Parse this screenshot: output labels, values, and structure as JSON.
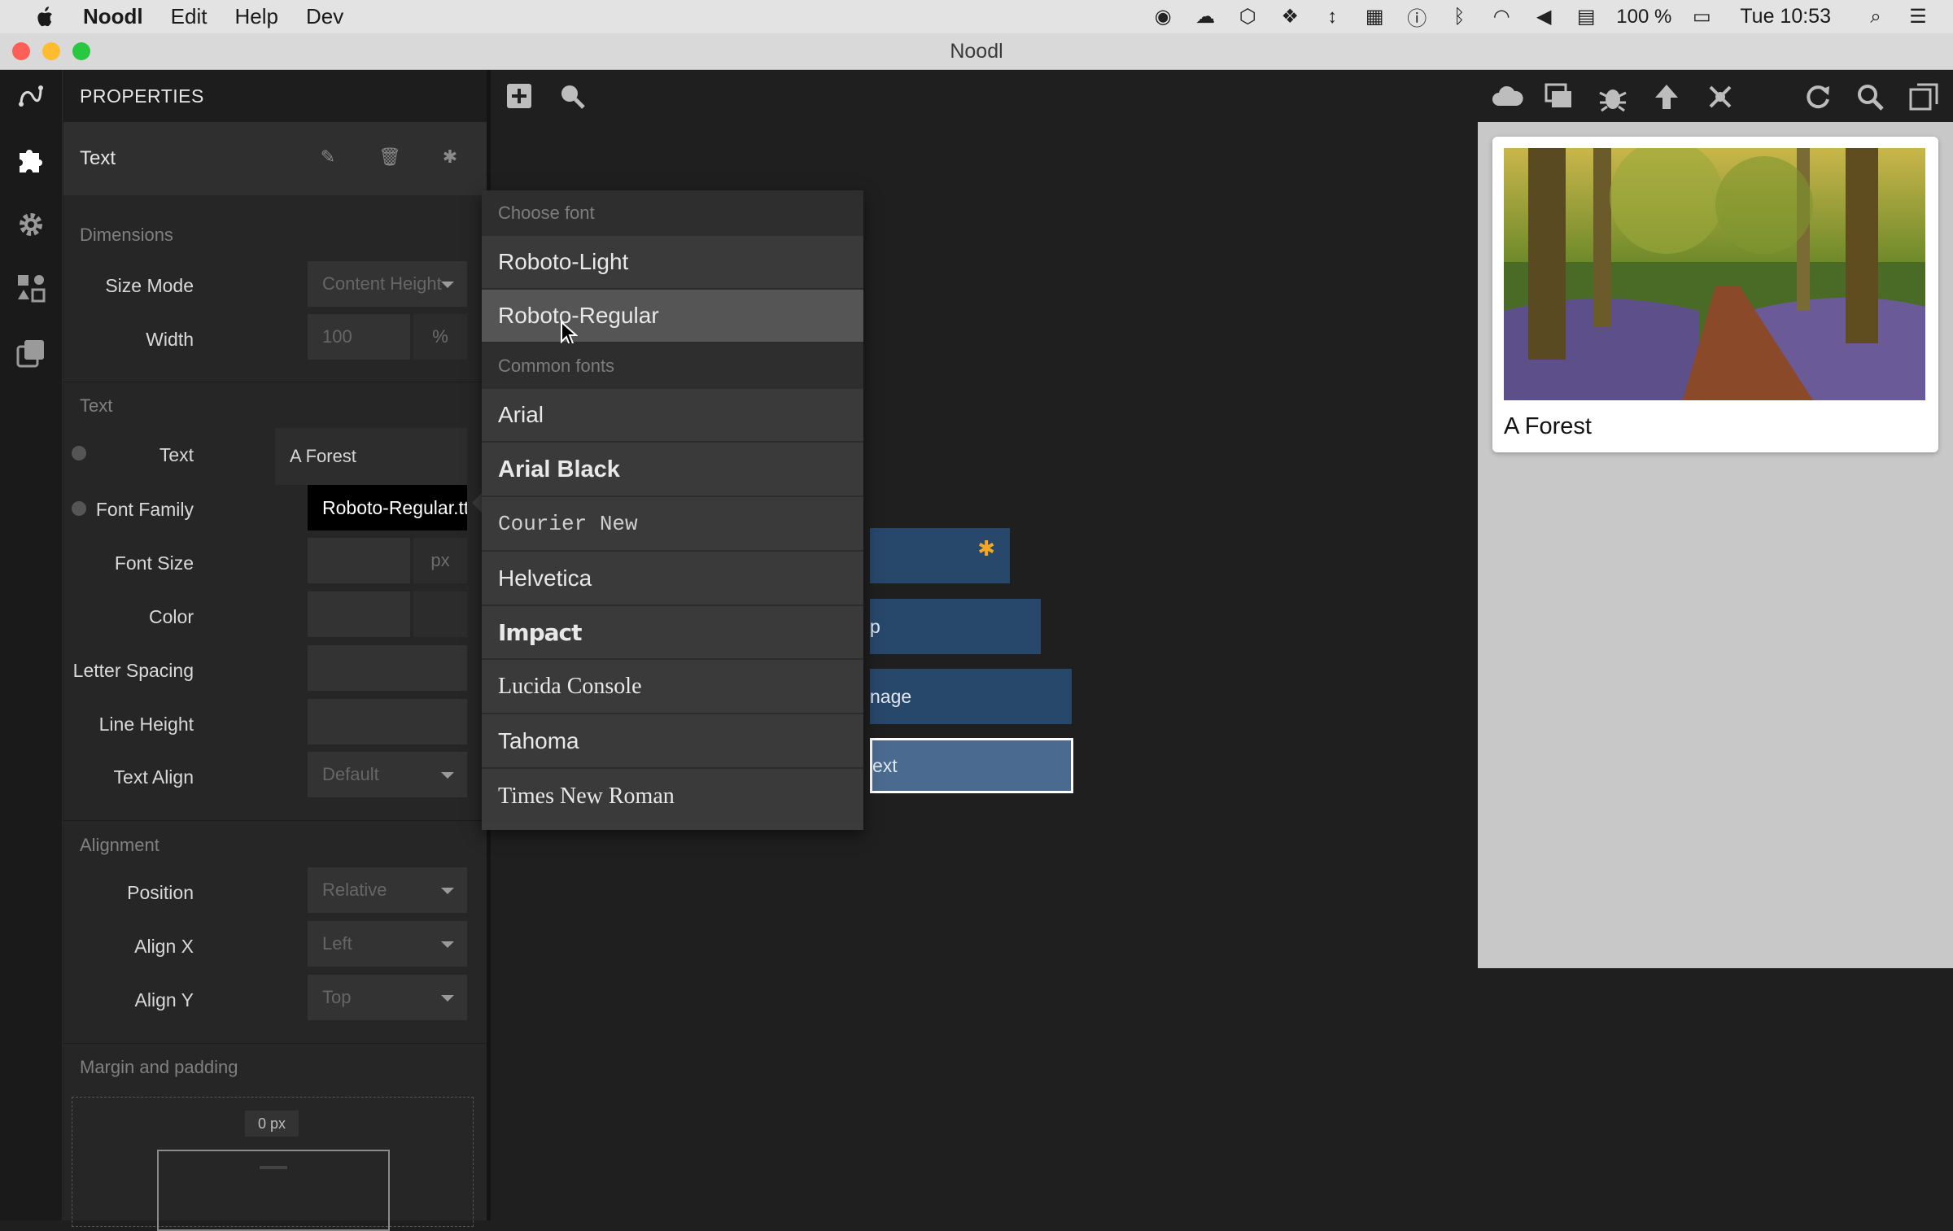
{
  "menubar": {
    "app_name": "Noodl",
    "menus": [
      "Edit",
      "Help",
      "Dev"
    ],
    "battery": "100 %",
    "clock": "Tue 10:53"
  },
  "window": {
    "title": "Noodl"
  },
  "properties": {
    "header": "PROPERTIES",
    "node_type": "Text",
    "sections": {
      "dimensions": "Dimensions",
      "text": "Text",
      "alignment": "Alignment",
      "margin": "Margin and padding"
    },
    "size_mode_label": "Size Mode",
    "size_mode_value": "Content Height",
    "width_label": "Width",
    "width_value": "100",
    "width_unit": "%",
    "text_label": "Text",
    "text_value": "A Forest",
    "font_family_label": "Font Family",
    "font_family_value": "Roboto-Regular.ttf",
    "font_size_label": "Font Size",
    "font_size_unit": "px",
    "color_label": "Color",
    "letter_spacing_label": "Letter Spacing",
    "line_height_label": "Line Height",
    "text_align_label": "Text Align",
    "text_align_value": "Default",
    "position_label": "Position",
    "position_value": "Relative",
    "align_x_label": "Align X",
    "align_x_value": "Left",
    "align_y_label": "Align Y",
    "align_y_value": "Top",
    "margin_value": "0 px"
  },
  "font_dropdown": {
    "group_choose": "Choose font",
    "group_common": "Common fonts",
    "choose_options": [
      "Roboto-Light",
      "Roboto-Regular"
    ],
    "common_options": [
      "Arial",
      "Arial Black",
      "Courier New",
      "Helvetica",
      "Impact",
      "Lucida Console",
      "Tahoma",
      "Times New Roman"
    ],
    "hovered": "Roboto-Regular"
  },
  "canvas_nodes": {
    "node2": "p",
    "node3": "nage",
    "node4": "ext"
  },
  "preview": {
    "card_title": "A Forest"
  },
  "colors": {
    "accent": "#f5a623",
    "node_blue": "#27476b",
    "node_selected": "#4a6a8f"
  }
}
